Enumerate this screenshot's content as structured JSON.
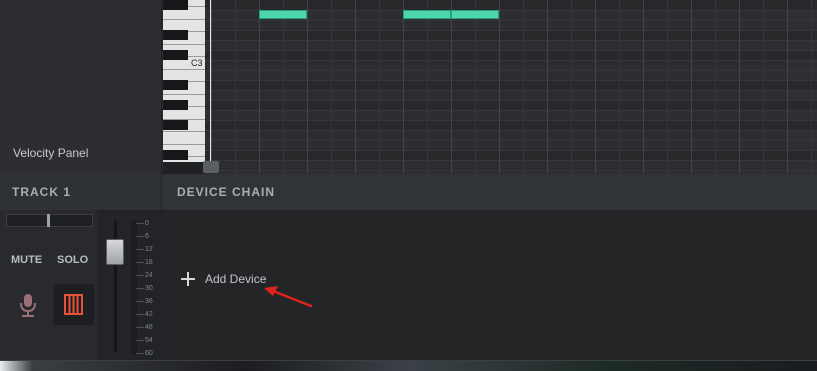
{
  "piano_roll": {
    "velocity_panel_label": "Velocity Panel",
    "octave_label": "C3",
    "note_color": "#4fd6ac"
  },
  "track": {
    "title": "TRACK 1",
    "mute_label": "MUTE",
    "solo_label": "SOLO",
    "mic_icon": "microphone-icon",
    "keys_icon": "piano-keys-icon",
    "keys_icon_color": "#e8523a",
    "meter_labels": [
      "0",
      "6",
      "12",
      "18",
      "24",
      "30",
      "36",
      "42",
      "48",
      "54",
      "60"
    ]
  },
  "device_chain": {
    "title": "DEVICE CHAIN",
    "add_device_label": "Add Device",
    "annotation_arrow_color": "#e0241b"
  }
}
